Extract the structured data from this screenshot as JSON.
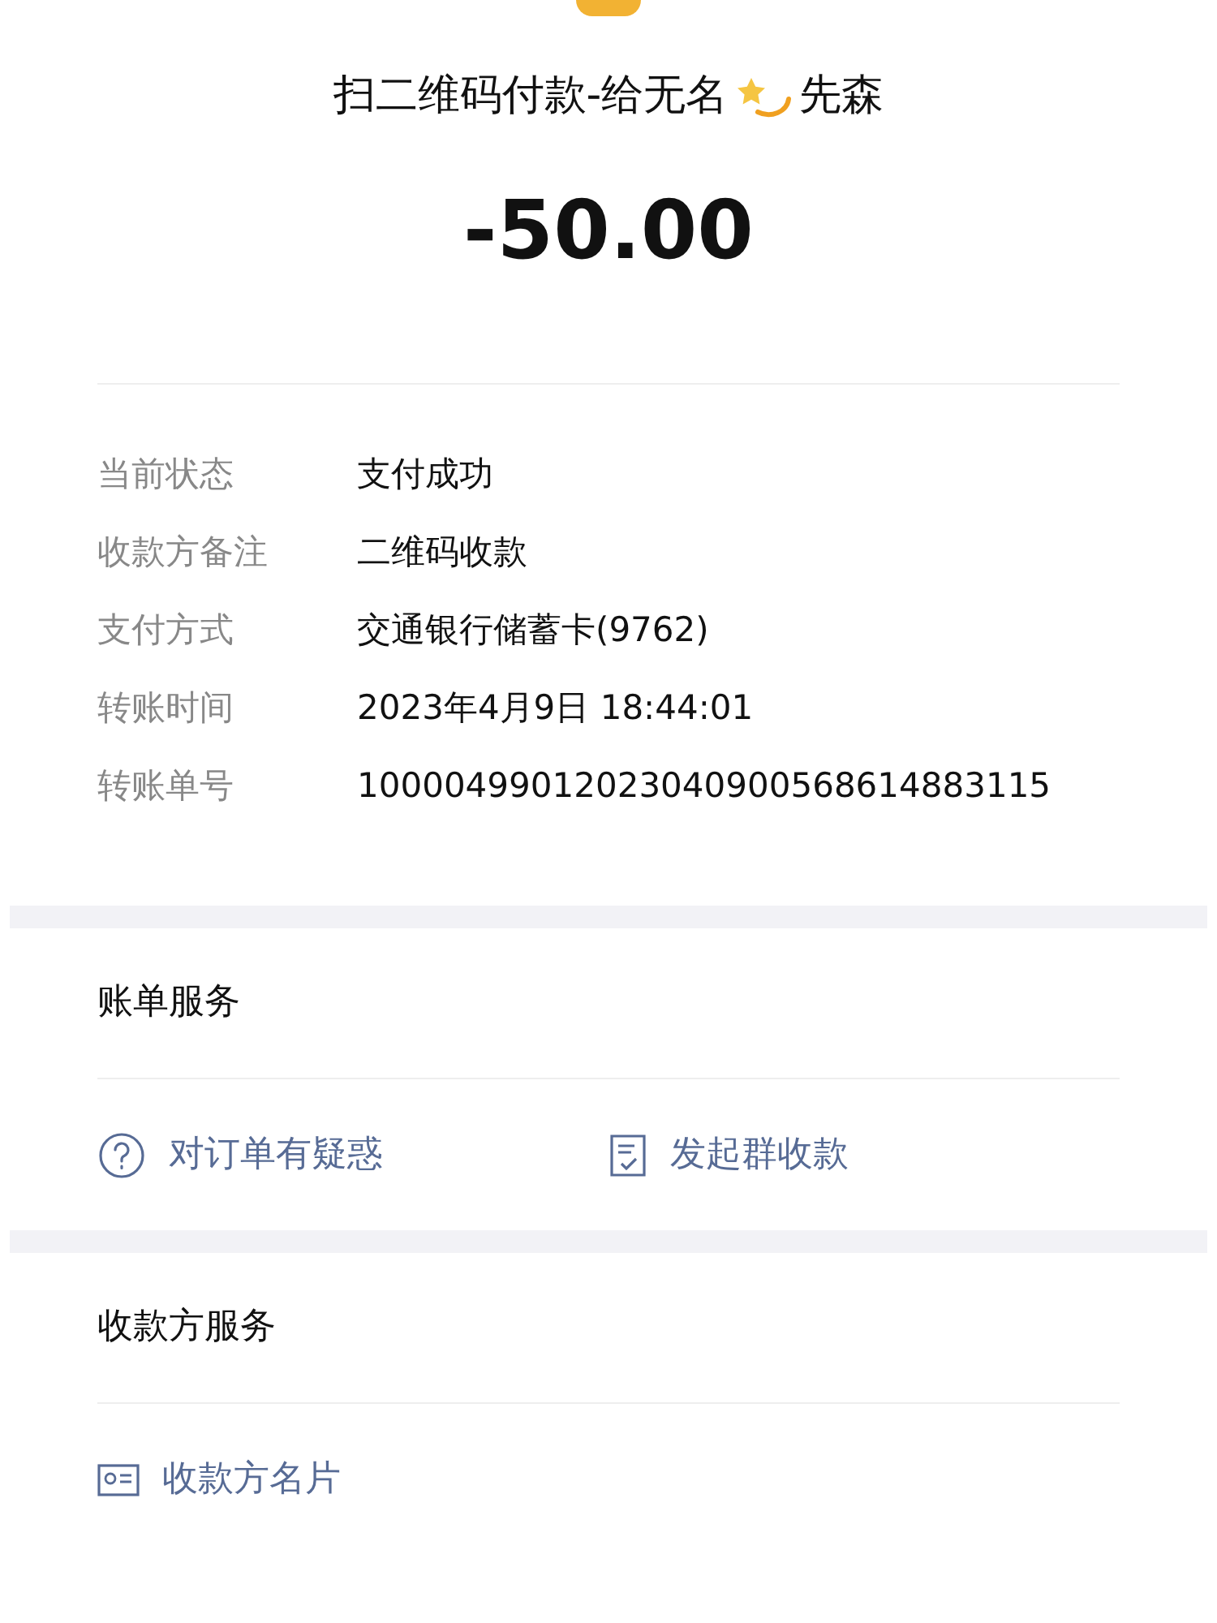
{
  "header": {
    "title": "扫二维码付款-给无名",
    "title_suffix": "先森",
    "amount": "-50.00"
  },
  "details": [
    {
      "label": "当前状态",
      "value": "支付成功"
    },
    {
      "label": "收款方备注",
      "value": "二维码收款"
    },
    {
      "label": "支付方式",
      "value": "交通银行储蓄卡(9762)"
    },
    {
      "label": "转账时间",
      "value": "2023年4月9日 18:44:01"
    },
    {
      "label": "转账单号",
      "value": "10000499012023040900568614883115"
    }
  ],
  "sections": [
    {
      "title": "账单服务",
      "actions": [
        {
          "kind": "question",
          "label": "对订单有疑惑"
        },
        {
          "kind": "checklist",
          "label": "发起群收款"
        }
      ]
    },
    {
      "title": "收款方服务",
      "actions": [
        {
          "kind": "card",
          "label": "收款方名片"
        }
      ]
    }
  ]
}
